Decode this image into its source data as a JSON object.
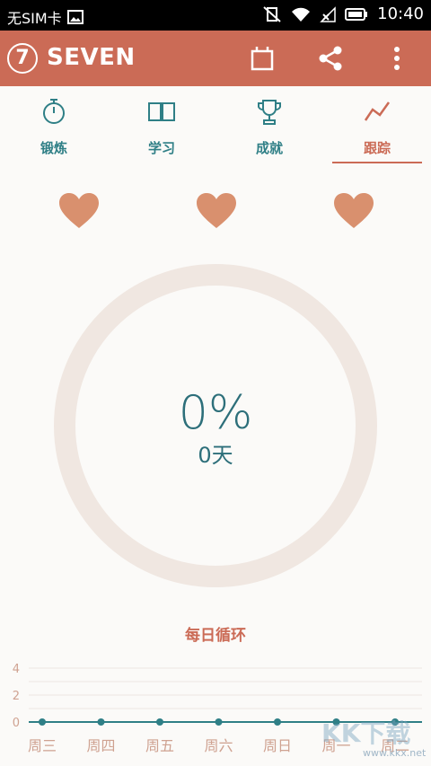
{
  "status_bar": {
    "carrier": "无SIM卡",
    "time": "10:40"
  },
  "app_bar": {
    "logo_mark": "7",
    "title": "SEVEN"
  },
  "tabs": [
    {
      "label": "锻炼",
      "icon": "stopwatch-icon",
      "active": false
    },
    {
      "label": "学习",
      "icon": "book-icon",
      "active": false
    },
    {
      "label": "成就",
      "icon": "trophy-icon",
      "active": false
    },
    {
      "label": "跟踪",
      "icon": "trend-line-icon",
      "active": true
    }
  ],
  "hearts": {
    "count": 3,
    "color": "#d9906e"
  },
  "progress": {
    "percent_text": "0%",
    "days_text": "0天",
    "value": 0
  },
  "colors": {
    "accent": "#cb6b56",
    "teal": "#2f7f86",
    "ring": "#f0e7e1",
    "heart": "#d9906e"
  },
  "chart_data": {
    "type": "line",
    "title": "每日循环",
    "categories": [
      "周三",
      "周四",
      "周五",
      "周六",
      "周日",
      "周一",
      "周二"
    ],
    "series": [
      {
        "values": [
          0,
          0,
          0,
          0,
          0,
          0,
          0
        ]
      }
    ],
    "y_ticks": [
      0,
      2,
      4
    ],
    "ylim": [
      0,
      4
    ]
  },
  "watermark": {
    "text": "KK下载",
    "url": "www.kkx.net"
  }
}
